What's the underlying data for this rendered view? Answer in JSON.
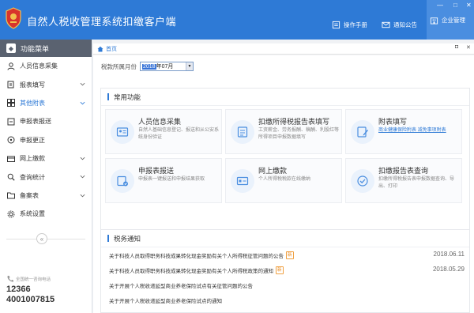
{
  "app": {
    "title": "自然人税收管理系统扣缴客户端",
    "header_buttons": {
      "manual": "操作手册",
      "notice": "通知公告",
      "company": "企业管理"
    }
  },
  "sidebar": {
    "menu_title": "功能菜单",
    "items": [
      {
        "label": "人员信息采集",
        "icon": "person-icon",
        "has_chevron": false
      },
      {
        "label": "报表填写",
        "icon": "document-edit-icon",
        "has_chevron": true
      },
      {
        "label": "其他附表",
        "icon": "grid-icon",
        "has_chevron": true,
        "active": true
      },
      {
        "label": "申报表报送",
        "icon": "send-icon",
        "has_chevron": false
      },
      {
        "label": "申报更正",
        "icon": "correct-icon",
        "has_chevron": false
      },
      {
        "label": "网上缴款",
        "icon": "card-icon",
        "has_chevron": true
      },
      {
        "label": "查询统计",
        "icon": "query-icon",
        "has_chevron": true
      },
      {
        "label": "备案表",
        "icon": "folder-icon",
        "has_chevron": true
      },
      {
        "label": "系统设置",
        "icon": "gear-icon",
        "has_chevron": false
      }
    ],
    "collapse_symbol": "«",
    "hotline": {
      "label": "全国统一咨询电话",
      "number1": "12366",
      "number2": "4001007815"
    }
  },
  "tabs": {
    "home": "首页"
  },
  "month_selector": {
    "label": "税款所属月份",
    "value_selected": "2018",
    "value_rest": "年07月"
  },
  "common_functions": {
    "title": "常用功能",
    "cards": [
      {
        "title": "人员信息采集",
        "desc": "自然人基础信息登记、报送和从公安系统身份验证",
        "link": false
      },
      {
        "title": "扣缴所得税报告表填写",
        "desc": "工资薪金、劳务报酬、稿酬、利股红等所得项目申报数据填写",
        "link": false
      },
      {
        "title": "附表填写",
        "desc": "商业健康保险附表 减免事项附表",
        "link": true
      },
      {
        "title": "申报表报送",
        "desc": "申报表一键报送和申报结果获取",
        "link": false
      },
      {
        "title": "网上缴款",
        "desc": "个人所得税税款在线缴纳",
        "link": false
      },
      {
        "title": "扣缴报告表查询",
        "desc": "扣缴所得税报告表申报数据查询、导出、打印",
        "link": false
      }
    ]
  },
  "tax_notices": {
    "title": "税务通知",
    "items": [
      {
        "text": "关于科技人员取得职务科技成果转化现金奖励有关个人所得税征管问题的公告",
        "new": true,
        "date": "2018.06.11"
      },
      {
        "text": "关于科技人员取得职务科技成果转化现金奖励有关个人所得税政策的通知",
        "new": true,
        "date": "2018.05.29"
      },
      {
        "text": "关于开展个人税收递延型商业养老保险试点有关征管问题的公告",
        "new": false,
        "date": ""
      },
      {
        "text": "关于开展个人税收递延型商业养老保险试点的通知",
        "new": false,
        "date": ""
      }
    ],
    "new_badge": "新"
  }
}
